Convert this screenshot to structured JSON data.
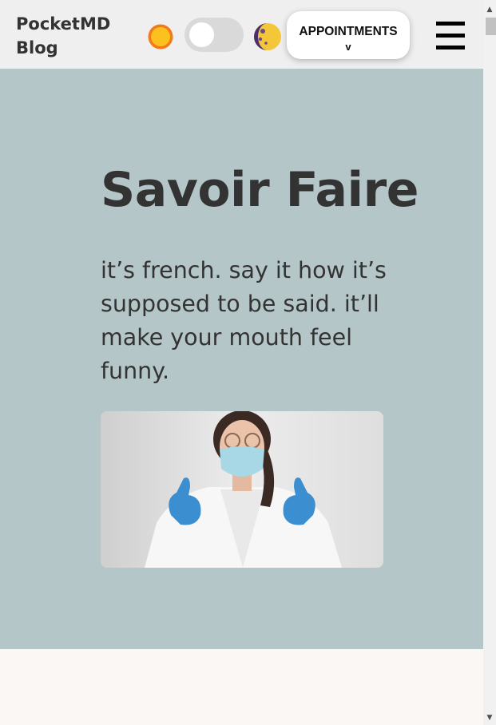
{
  "header": {
    "brand": "PocketMD Blog",
    "theme_toggle": {
      "state": "light",
      "light_icon": "sun-icon",
      "dark_icon": "moon-icon"
    },
    "appointments_label": "APPOINTMENTS",
    "appointments_caret": "v",
    "menu_icon": "hamburger-menu-icon"
  },
  "hero": {
    "title": "Savoir Faire",
    "text": "it’s french. say it how it’s supposed to be said. it’ll make your mouth feel funny.",
    "image": "doctor-thumbs-up-photo"
  },
  "scrollbar": {
    "up": "▲",
    "down": "▼"
  },
  "colors": {
    "header_bg": "#efefef",
    "hero_bg": "#b5c6c8",
    "page_bg": "#faf7f5",
    "text": "#333333",
    "sun": "#f9b233",
    "moon": "#4a2f6b"
  }
}
